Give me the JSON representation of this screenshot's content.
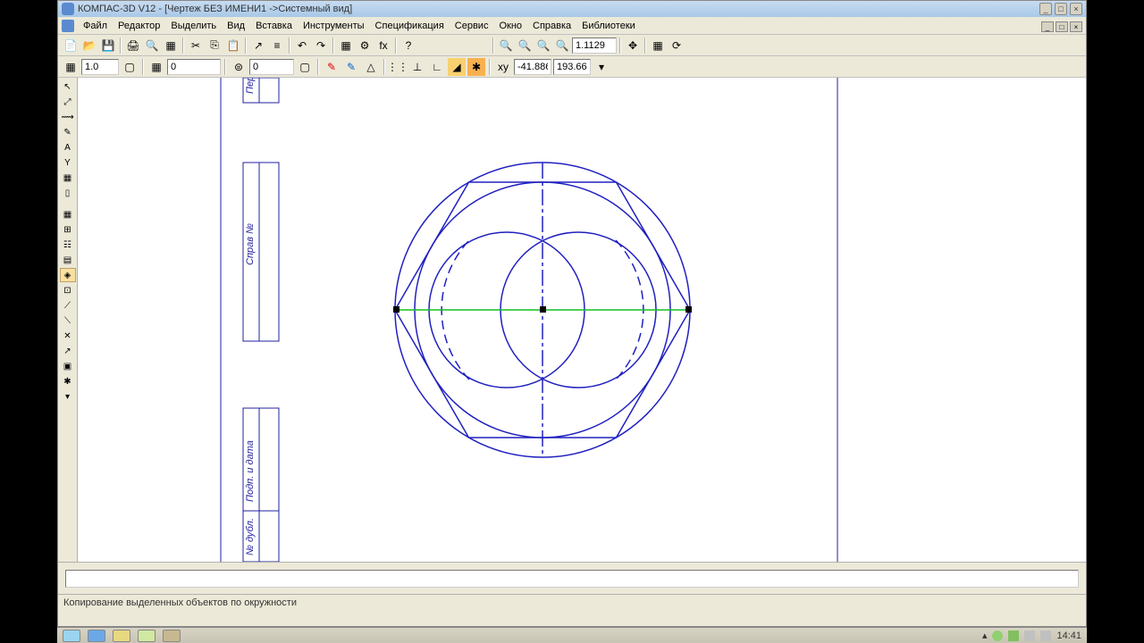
{
  "title": "КОМПАС-3D V12 - [Чертеж БЕЗ ИМЕНИ1 ->Системный вид]",
  "menu": [
    "Файл",
    "Редактор",
    "Выделить",
    "Вид",
    "Вставка",
    "Инструменты",
    "Спецификация",
    "Сервис",
    "Окно",
    "Справка",
    "Библиотеки"
  ],
  "toolbar1": {
    "zoom": "1.1129"
  },
  "toolbar2": {
    "val1": "1.0",
    "val2": "0",
    "coordX": "-41.886",
    "coordY": "193.66"
  },
  "status": "Копирование выделенных объектов по окружности",
  "tray": {
    "time": "14:41"
  },
  "stamp": {
    "t1": "Перв",
    "t2": "Справ №",
    "t3": "Подп. и дата",
    "t4": "№ дубл."
  }
}
